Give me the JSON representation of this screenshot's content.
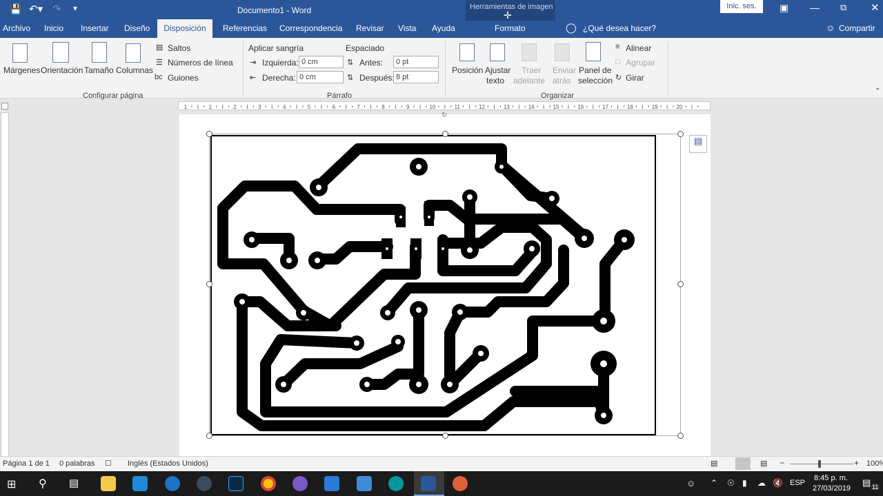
{
  "titlebar": {
    "doc_title": "Documento1 - Word",
    "context_tab": "Herramientas de imagen",
    "signin": "Inic. ses."
  },
  "menu": {
    "items": [
      "Archivo",
      "Inicio",
      "Insertar",
      "Diseño",
      "Disposición",
      "Referencias",
      "Correspondencia",
      "Revisar",
      "Vista",
      "Ayuda"
    ],
    "context": "Formato",
    "tell_me": "¿Qué desea hacer?",
    "share": "Compartir"
  },
  "ribbon": {
    "page_setup": {
      "margins": "Márgenes",
      "orientation": "Orientación",
      "size": "Tamaño",
      "columns": "Columnas",
      "breaks": "Saltos",
      "line_numbers": "Números de línea",
      "hyphenation": "Guiones",
      "group": "Configurar página"
    },
    "paragraph": {
      "indent_title": "Aplicar sangría",
      "spacing_title": "Espaciado",
      "left_label": "Izquierda:",
      "left_value": "0 cm",
      "right_label": "Derecha:",
      "right_value": "0 cm",
      "before_label": "Antes:",
      "before_value": "0 pt",
      "after_label": "Después:",
      "after_value": "8 pt",
      "group": "Párrafo"
    },
    "arrange": {
      "position": "Posición",
      "wrap1": "Ajustar",
      "wrap2": "texto",
      "forward1": "Traer",
      "forward2": "adelante",
      "backward1": "Enviar",
      "backward2": "atrás",
      "pane1": "Panel de",
      "pane2": "selección",
      "align": "Alinear",
      "group_btn": "Agrupar",
      "rotate": "Girar",
      "group": "Organizar"
    }
  },
  "ruler": {
    "labels": [
      "1",
      "1",
      "2",
      "3",
      "4",
      "5",
      "6",
      "7",
      "8",
      "9",
      "10",
      "11",
      "12",
      "13",
      "14",
      "15",
      "16",
      "17",
      "18",
      "19",
      "20"
    ]
  },
  "status": {
    "page": "Página 1 de 1",
    "words": "0 palabras",
    "language": "Inglés (Estados Unidos)",
    "zoom": "100%"
  },
  "taskbar": {
    "lang": "ESP",
    "time": "8:45 p. m.",
    "date": "27/03/2019",
    "notifications": "11"
  },
  "colors": {
    "word_blue": "#2b579a",
    "taskbar": "#1b1b1b"
  }
}
